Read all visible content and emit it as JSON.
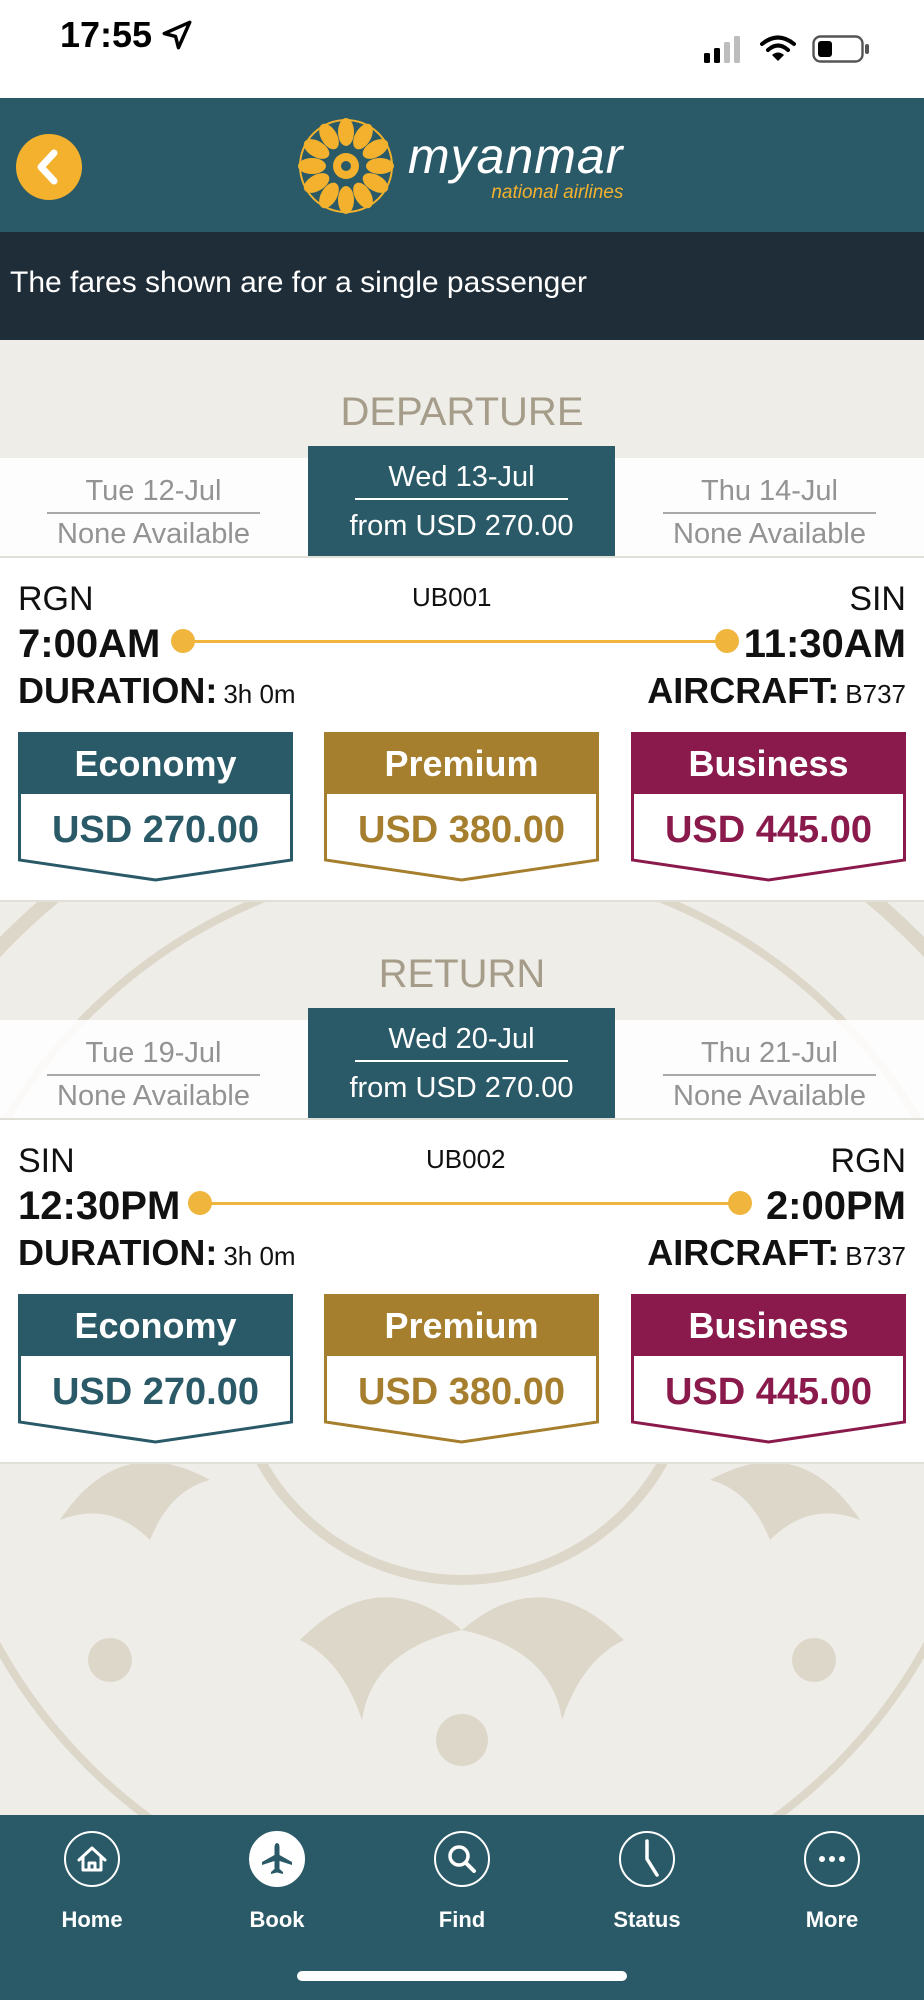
{
  "status_bar": {
    "time": "17:55"
  },
  "header": {
    "brand_name": "myanmar",
    "brand_sub": "national airlines"
  },
  "notice": "The fares shown are for a single passenger",
  "colors": {
    "header": "#2a5a67",
    "accent": "#f3b12d",
    "economy": "#2a5a67",
    "premium": "#a57e2e",
    "business": "#8b1a4c"
  },
  "departure": {
    "title": "DEPARTURE",
    "dates": [
      {
        "date": "Tue 12-Jul",
        "sub": "None Available"
      },
      {
        "date": "Wed 13-Jul",
        "sub": "from USD 270.00",
        "selected": true
      },
      {
        "date": "Thu 14-Jul",
        "sub": "None Available"
      }
    ],
    "flight": {
      "origin": "RGN",
      "destination": "SIN",
      "flight_no": "UB001",
      "dep_time": "7:00AM",
      "arr_time": "11:30AM",
      "duration_label": "DURATION:",
      "duration": "3h 0m",
      "aircraft_label": "AIRCRAFT:",
      "aircraft": "B737",
      "fares": [
        {
          "class": "Economy",
          "price": "USD 270.00"
        },
        {
          "class": "Premium",
          "price": "USD 380.00"
        },
        {
          "class": "Business",
          "price": "USD 445.00"
        }
      ]
    }
  },
  "return": {
    "title": "RETURN",
    "dates": [
      {
        "date": "Tue 19-Jul",
        "sub": "None Available"
      },
      {
        "date": "Wed 20-Jul",
        "sub": "from USD 270.00",
        "selected": true
      },
      {
        "date": "Thu 21-Jul",
        "sub": "None Available"
      }
    ],
    "flight": {
      "origin": "SIN",
      "destination": "RGN",
      "flight_no": "UB002",
      "dep_time": "12:30PM",
      "arr_time": "2:00PM",
      "duration_label": "DURATION:",
      "duration": "3h 0m",
      "aircraft_label": "AIRCRAFT:",
      "aircraft": "B737",
      "fares": [
        {
          "class": "Economy",
          "price": "USD 270.00"
        },
        {
          "class": "Premium",
          "price": "USD 380.00"
        },
        {
          "class": "Business",
          "price": "USD 445.00"
        }
      ]
    }
  },
  "nav": {
    "items": [
      {
        "label": "Home",
        "icon": "home-icon"
      },
      {
        "label": "Book",
        "icon": "plane-icon",
        "active": true
      },
      {
        "label": "Find",
        "icon": "search-icon"
      },
      {
        "label": "Status",
        "icon": "clock-icon"
      },
      {
        "label": "More",
        "icon": "more-icon"
      }
    ]
  }
}
